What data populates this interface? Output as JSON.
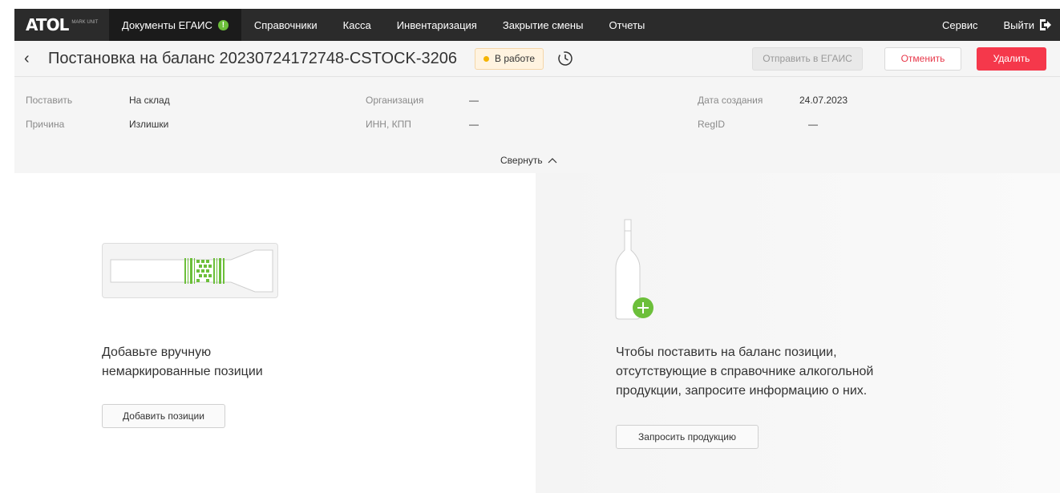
{
  "nav": {
    "logo_text": "ATOL",
    "logo_sub": "MARK UNIT",
    "items": [
      {
        "label": "Документы ЕГАИС",
        "active": true,
        "badge": "!"
      },
      {
        "label": "Справочники"
      },
      {
        "label": "Касса"
      },
      {
        "label": "Инвентаризация"
      },
      {
        "label": "Закрытие смены"
      },
      {
        "label": "Отчеты"
      }
    ],
    "service": "Сервис",
    "logout": "Выйти"
  },
  "header": {
    "back": "‹",
    "title": "Постановка на баланс 20230724172748-CSTOCK-3206",
    "status": "В работе",
    "status_color": "#f5b400",
    "send_button": "Отправить в ЕГАИС",
    "cancel_button": "Отменить",
    "delete_button": "Удалить"
  },
  "info": {
    "put_label": "Поставить",
    "put_value": "На склад",
    "reason_label": "Причина",
    "reason_value": "Излишки",
    "org_label": "Организация",
    "org_value": "—",
    "inn_label": "ИНН, КПП",
    "inn_value": "—",
    "created_label": "Дата создания",
    "created_value": "24.07.2023",
    "regid_label": "RegID",
    "regid_value": "—",
    "collapse": "Свернуть"
  },
  "left_panel": {
    "line1": "Добавьте вручную",
    "line2": "немаркированные позиции",
    "button": "Добавить позиции"
  },
  "right_panel": {
    "line1": "Чтобы поставить на баланс позиции,",
    "line2": "отсутствующие в справочнике алкогольной",
    "line3": "продукции, запросите информацию о них.",
    "button": "Запросить продукцию"
  },
  "colors": {
    "accent_green": "#6cbf3a",
    "danger_red": "#f5384b",
    "nav_bg": "#2b2b2b"
  }
}
